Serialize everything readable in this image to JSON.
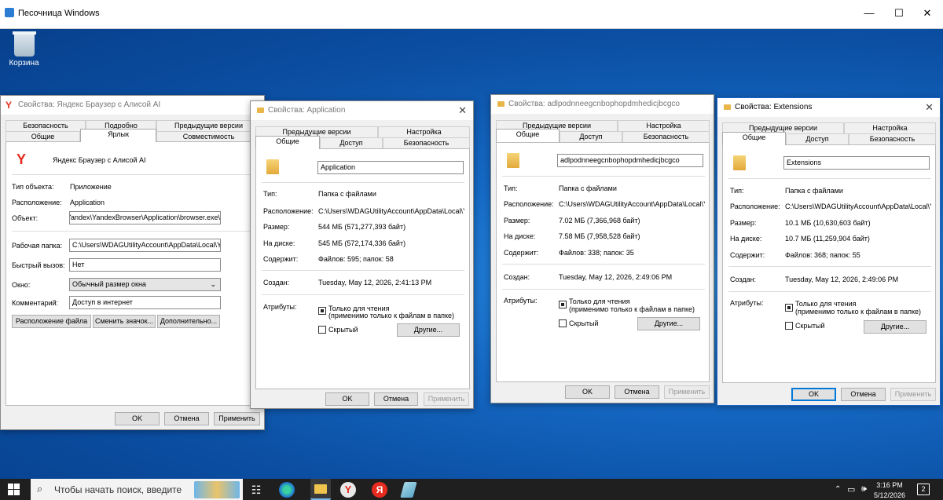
{
  "sandbox": {
    "title": "Песочница Windows",
    "min": "—",
    "max": "☐",
    "close": "✕"
  },
  "desktop": {
    "recycle": "Корзина"
  },
  "w1": {
    "title": "Свойства: Яндекс Браузер с Алисой AI",
    "tabs_top": [
      "Безопасность",
      "Подробно",
      "Предыдущие версии"
    ],
    "tabs_bottom": [
      "Общие",
      "Ярлык",
      "Совместимость"
    ],
    "name": "Яндекс Браузер с Алисой AI",
    "type_l": "Тип объекта:",
    "type_v": "Приложение",
    "loc_l": "Расположение:",
    "loc_v": "Application",
    "obj_l": "Объект:",
    "obj_v": "\\Yandex\\YandexBrowser\\Application\\browser.exe",
    "wd_l": "Рабочая папка:",
    "wd_v": "C:\\Users\\WDAGUtilityAccount\\AppData\\Local\\Ya",
    "hk_l": "Быстрый вызов:",
    "hk_v": "Нет",
    "win_l": "Окно:",
    "win_v": "Обычный размер окна",
    "com_l": "Комментарий:",
    "com_v": "Доступ в интернет",
    "b1": "Расположение файла",
    "b2": "Сменить значок...",
    "b3": "Дополнительно...",
    "ok": "OK",
    "cancel": "Отмена",
    "apply": "Применить"
  },
  "w2": {
    "title": "Свойства: Application",
    "tabs_top": [
      "Предыдущие версии",
      "Настройка"
    ],
    "tabs_bottom": [
      "Общие",
      "Доступ",
      "Безопасность"
    ],
    "name": "Application",
    "type_l": "Тип:",
    "type_v": "Папка с файлами",
    "loc_l": "Расположение:",
    "loc_v": "C:\\Users\\WDAGUtilityAccount\\AppData\\Local\\Y",
    "size_l": "Размер:",
    "size_v": "544 МБ (571,277,393 байт)",
    "disk_l": "На диске:",
    "disk_v": "545 МБ (572,174,336 байт)",
    "cont_l": "Содержит:",
    "cont_v": "Файлов: 595; папок: 58",
    "cr_l": "Создан:",
    "cr_v": "Tuesday, May 12, 2026, 2:41:13 PM",
    "attr_l": "Атрибуты:",
    "ro": "Только для чтения",
    "ro2": "(применимо только к файлам в папке)",
    "hid": "Скрытый",
    "other": "Другие...",
    "ok": "OK",
    "cancel": "Отмена",
    "apply": "Применить"
  },
  "w3": {
    "title": "Свойства: adlpodnneegcnbophopdmhedicjbcgco",
    "tabs_top": [
      "Предыдущие версии",
      "Настройка"
    ],
    "tabs_bottom": [
      "Общие",
      "Доступ",
      "Безопасность"
    ],
    "name": "adlpodnneegcnbophopdmhedicjbcgco",
    "type_l": "Тип:",
    "type_v": "Папка с файлами",
    "loc_l": "Расположение:",
    "loc_v": "C:\\Users\\WDAGUtilityAccount\\AppData\\Local\\Y",
    "size_l": "Размер:",
    "size_v": "7.02 МБ (7,366,968 байт)",
    "disk_l": "На диске:",
    "disk_v": "7.58 МБ (7,958,528 байт)",
    "cont_l": "Содержит:",
    "cont_v": "Файлов: 338; папок: 35",
    "cr_l": "Создан:",
    "cr_v": "Tuesday, May 12, 2026, 2:49:06 PM",
    "attr_l": "Атрибуты:",
    "ro": "Только для чтения",
    "ro2": "(применимо только к файлам в папке)",
    "hid": "Скрытый",
    "other": "Другие...",
    "ok": "OK",
    "cancel": "Отмена",
    "apply": "Применить"
  },
  "w4": {
    "title": "Свойства: Extensions",
    "tabs_top": [
      "Предыдущие версии",
      "Настройка"
    ],
    "tabs_bottom": [
      "Общие",
      "Доступ",
      "Безопасность"
    ],
    "name": "Extensions",
    "type_l": "Тип:",
    "type_v": "Папка с файлами",
    "loc_l": "Расположение:",
    "loc_v": "C:\\Users\\WDAGUtilityAccount\\AppData\\Local\\Y",
    "size_l": "Размер:",
    "size_v": "10.1 МБ (10,630,603 байт)",
    "disk_l": "На диске:",
    "disk_v": "10.7 МБ (11,259,904 байт)",
    "cont_l": "Содержит:",
    "cont_v": "Файлов: 368; папок: 55",
    "cr_l": "Создан:",
    "cr_v": "Tuesday, May 12, 2026, 2:49:06 PM",
    "attr_l": "Атрибуты:",
    "ro": "Только для чтения",
    "ro2": "(применимо только к файлам в папке)",
    "hid": "Скрытый",
    "other": "Другие...",
    "ok": "OK",
    "cancel": "Отмена",
    "apply": "Применить"
  },
  "taskbar": {
    "search": "Чтобы начать поиск, введите",
    "time": "3:16 PM",
    "date": "5/12/2026",
    "notif": "2"
  }
}
